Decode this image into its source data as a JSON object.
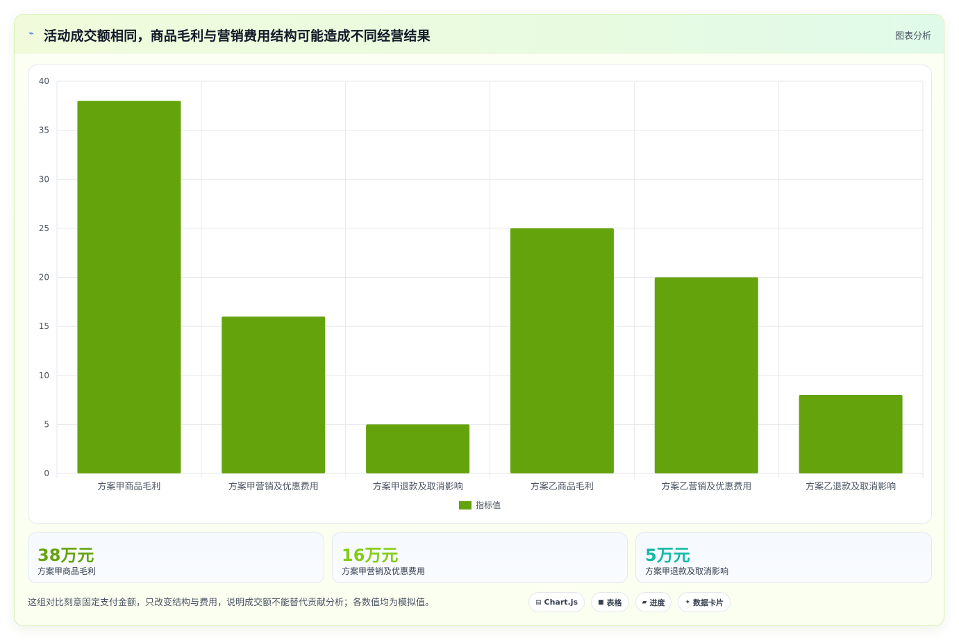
{
  "header": {
    "icon": "lightning-icon",
    "icon_glyph": "⌁",
    "title": "活动成交额相同，商品毛利与营销费用结构可能造成不同经营结果",
    "tag": "图表分析"
  },
  "chart_data": {
    "type": "bar",
    "categories": [
      "方案甲商品毛利",
      "方案甲营销及优惠费用",
      "方案甲退款及取消影响",
      "方案乙商品毛利",
      "方案乙营销及优惠费用",
      "方案乙退款及取消影响"
    ],
    "series": [
      {
        "name": "指标值",
        "values": [
          38,
          16,
          5,
          25,
          20,
          8
        ],
        "color": "#65a30d"
      }
    ],
    "ylim": [
      0,
      40
    ],
    "yticks": [
      0,
      5,
      10,
      15,
      20,
      25,
      30,
      35,
      40
    ],
    "grid": true,
    "legend": "bottom",
    "title": "",
    "xlabel": "",
    "ylabel": ""
  },
  "stats": [
    {
      "value": "38万元",
      "label": "方案甲商品毛利",
      "color": "#65a30d"
    },
    {
      "value": "16万元",
      "label": "方案甲营销及优惠费用",
      "color": "#84cc16"
    },
    {
      "value": "5万元",
      "label": "方案甲退款及取消影响",
      "color": "#14b8a6"
    }
  ],
  "footnote": "这组对比刻意固定支付金额，只改变结构与费用，说明成交额不能替代贡献分析；各数值均为模拟值。",
  "chips": [
    {
      "icon": "chart-icon",
      "glyph": "▤",
      "label": "Chart.js"
    },
    {
      "icon": "table-icon",
      "glyph": "■",
      "label": "表格"
    },
    {
      "icon": "progress-icon",
      "glyph": "▰",
      "label": "进度"
    },
    {
      "icon": "data-card-icon",
      "glyph": "✦",
      "label": "数据卡片"
    }
  ]
}
